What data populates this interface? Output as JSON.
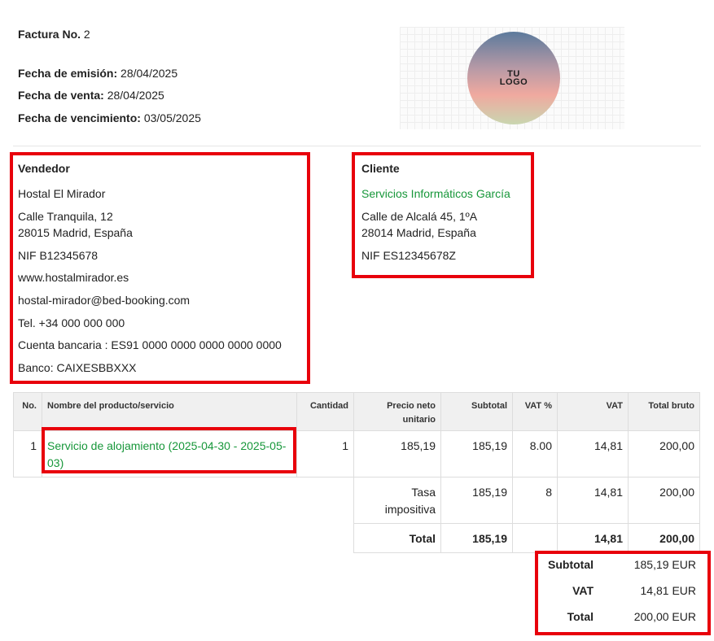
{
  "invoice": {
    "number_label": "Factura No.",
    "number_value": "2",
    "issue_label": "Fecha de emisión:",
    "issue_value": "28/04/2025",
    "sale_label": "Fecha de venta:",
    "sale_value": "28/04/2025",
    "due_label": "Fecha de vencimiento:",
    "due_value": "03/05/2025"
  },
  "logo": {
    "text": "TU\nLOGO"
  },
  "seller": {
    "title": "Vendedor",
    "name": "Hostal El Mirador",
    "street": "Calle Tranquila, 12",
    "city": "28015 Madrid, España",
    "nif": "NIF B12345678",
    "website": "www.hostalmirador.es",
    "email": "hostal-mirador@bed-booking.com",
    "phone": "Tel. +34 000 000 000",
    "bank_account": "Cuenta bancaria : ES91 0000 0000 0000 0000 0000",
    "bank": "Banco: CAIXESBBXXX"
  },
  "client": {
    "title": "Cliente",
    "name": "Servicios Informáticos García",
    "street": "Calle de Alcalá 45, 1ºA",
    "city": "28014 Madrid, España",
    "nif": "NIF ES12345678Z"
  },
  "table": {
    "headers": {
      "no": "No.",
      "name": "Nombre del producto/servicio",
      "qty": "Cantidad",
      "unit_price": "Precio neto unitario",
      "subtotal": "Subtotal",
      "vat_pct": "VAT %",
      "vat": "VAT",
      "gross": "Total bruto"
    },
    "rows": [
      {
        "no": "1",
        "name": "Servicio de alojamiento (2025-04-30 - 2025-05-03)",
        "qty": "1",
        "unit_price": "185,19",
        "subtotal": "185,19",
        "vat_pct": "8.00",
        "vat": "14,81",
        "gross": "200,00"
      }
    ],
    "tax_rate_row": {
      "label": "Tasa impositiva",
      "subtotal": "185,19",
      "rate": "8",
      "vat": "14,81",
      "gross": "200,00"
    },
    "total_row": {
      "label": "Total",
      "subtotal": "185,19",
      "vat": "14,81",
      "gross": "200,00"
    }
  },
  "summary": {
    "subtotal_label": "Subtotal",
    "subtotal_value": "185,19 EUR",
    "vat_label": "VAT",
    "vat_value": "14,81 EUR",
    "total_label": "Total",
    "total_value": "200,00 EUR"
  },
  "colors": {
    "highlight_border": "#e8000b",
    "link_green": "#17973a"
  }
}
